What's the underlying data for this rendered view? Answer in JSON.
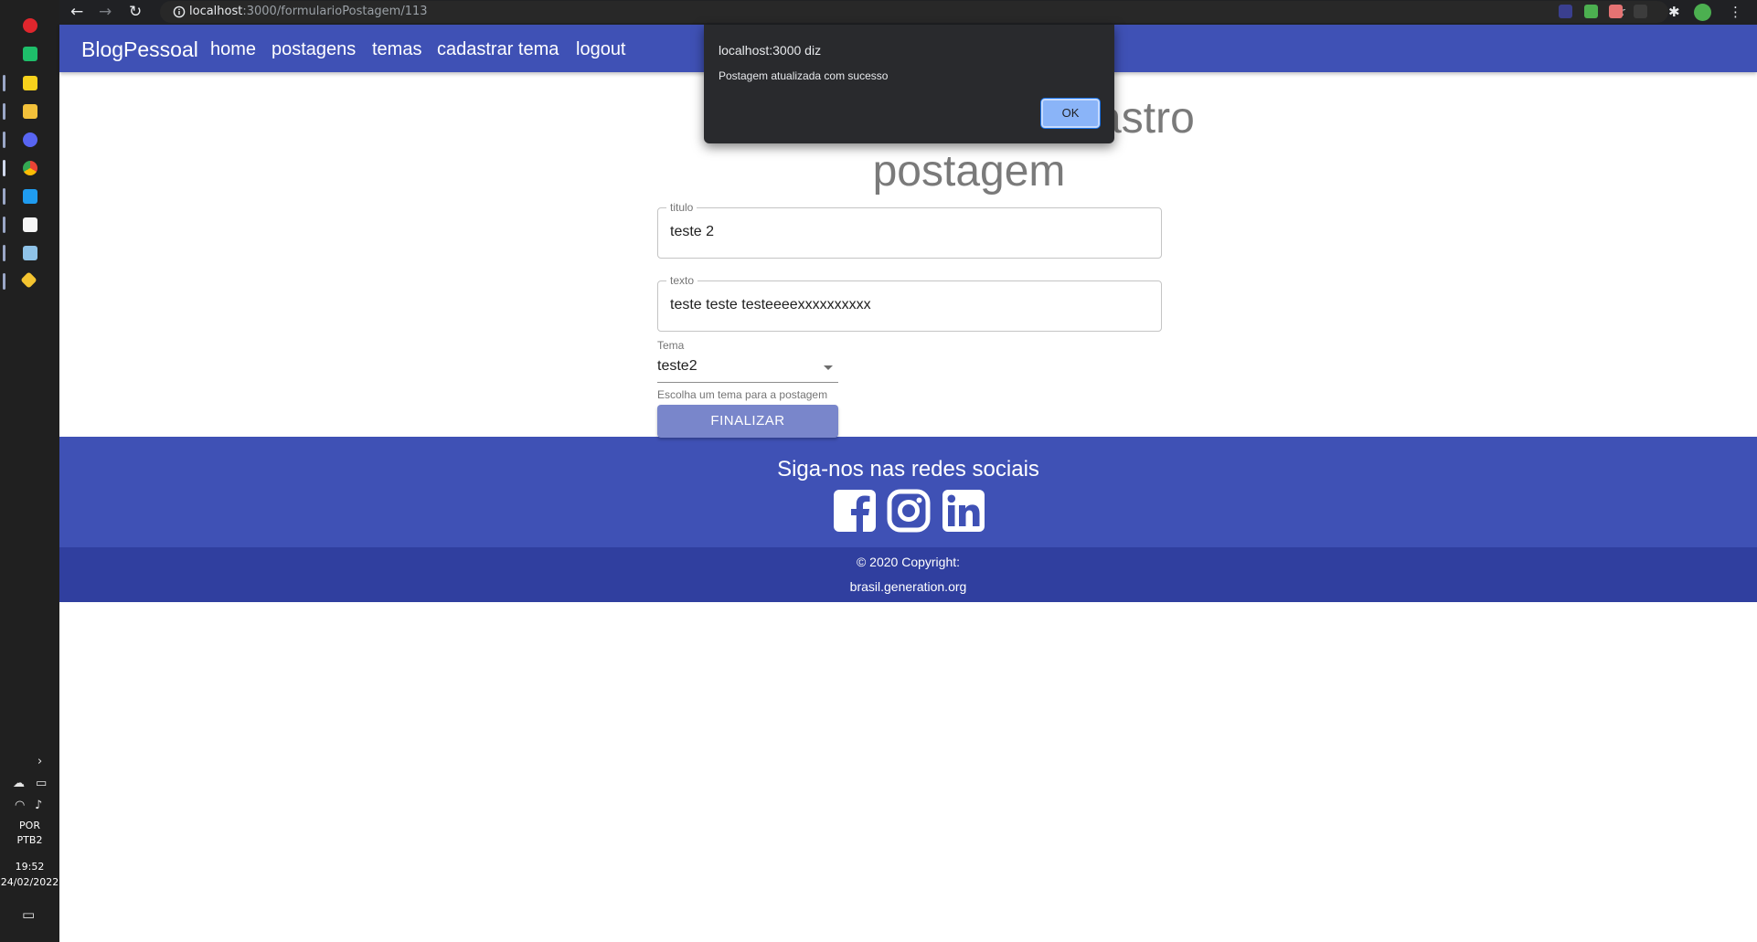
{
  "browser": {
    "url_host": "localhost",
    "url_path": ":3000/formularioPostagem/113"
  },
  "navbar": {
    "brand": "BlogPessoal",
    "links": [
      "home",
      "postagens",
      "temas",
      "cadastrar tema",
      "logout"
    ]
  },
  "form": {
    "title_line1": "Formulário de cadastro",
    "title_line2": "postagem",
    "titulo": {
      "label": "titulo",
      "value": "teste 2"
    },
    "texto": {
      "label": "texto",
      "value": "teste teste testeeeexxxxxxxxxx"
    },
    "tema": {
      "label": "Tema",
      "selected": "teste2",
      "helper": "Escolha um tema para a postagem"
    },
    "submit_label": "FINALIZAR"
  },
  "footer": {
    "heading": "Siga-nos nas redes sociais",
    "social_icons": [
      "facebook-icon",
      "instagram-icon",
      "linkedin-icon"
    ],
    "copyright": "© 2020 Copyright:",
    "site": "brasil.generation.org"
  },
  "alert": {
    "title": "localhost:3000 diz",
    "message": "Postagem atualizada com sucesso",
    "ok_label": "OK"
  },
  "taskbar": {
    "language_line1": "POR",
    "language_line2": "PTB2",
    "time": "19:52",
    "date": "24/02/2022"
  },
  "colors": {
    "primary": "#3f51b5",
    "primary_dark": "#303f9f",
    "button_disabled": "#7986cb"
  }
}
